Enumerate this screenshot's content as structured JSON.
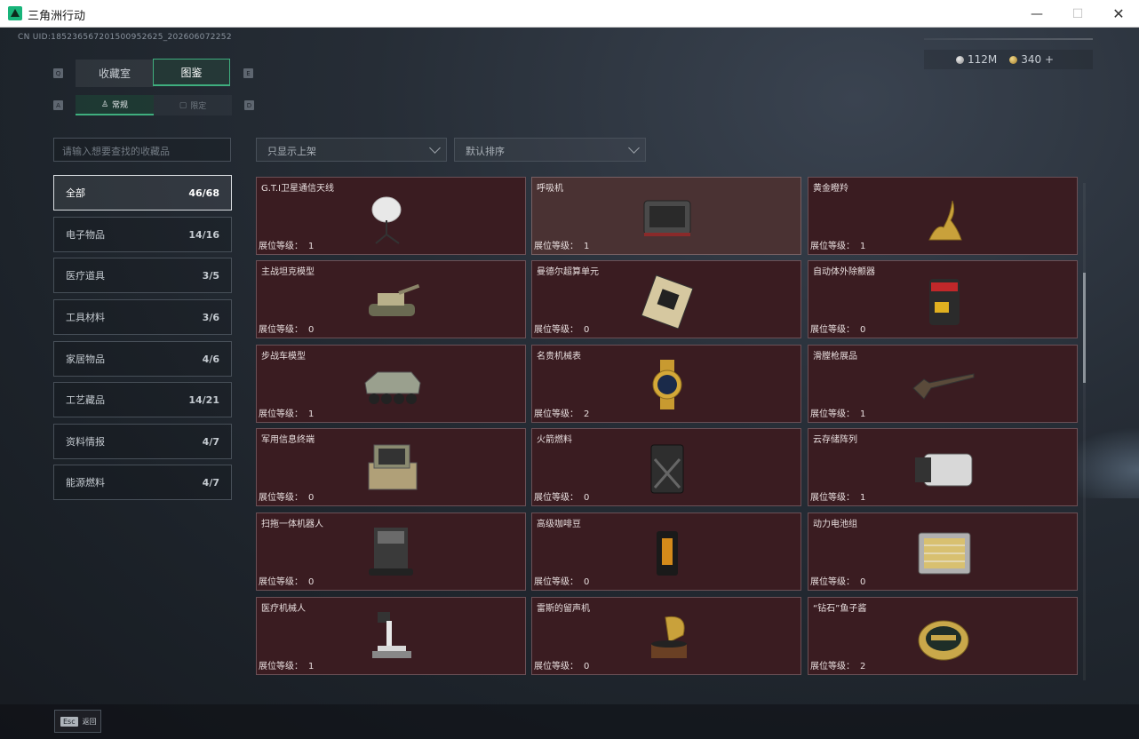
{
  "window": {
    "title": "三角洲行动",
    "minimize": "—",
    "maximize": "☐",
    "close": "✕"
  },
  "uid": "CN UID:18523656720150095262​5_202606072252",
  "currency": {
    "silver": "112M",
    "gold": "340 +"
  },
  "tabs": {
    "left_key": "Q",
    "right_key": "E",
    "collection": "收藏室",
    "atlas": "图鉴"
  },
  "subtabs": {
    "left_key": "A",
    "right_key": "D",
    "normal": "常规",
    "limited": "限定"
  },
  "search": {
    "placeholder": "请输入想要查找的收藏品"
  },
  "filters": {
    "shelf": "只显示上架",
    "sort": "默认排序"
  },
  "categories": [
    {
      "label": "全部",
      "count": "46/68"
    },
    {
      "label": "电子物品",
      "count": "14/16"
    },
    {
      "label": "医疗道具",
      "count": "3/5"
    },
    {
      "label": "工具材料",
      "count": "3/6"
    },
    {
      "label": "家居物品",
      "count": "4/6"
    },
    {
      "label": "工艺藏品",
      "count": "14/21"
    },
    {
      "label": "资料情报",
      "count": "4/7"
    },
    {
      "label": "能源燃料",
      "count": "4/7"
    }
  ],
  "level_label": "展位等级：",
  "items": [
    {
      "name": "G.T.I卫星通信天线",
      "level": "1",
      "icon": "satellite-dish-icon"
    },
    {
      "name": "呼吸机",
      "level": "1",
      "icon": "ventilator-icon"
    },
    {
      "name": "黄金瞪羚",
      "level": "1",
      "icon": "golden-gazelle-icon"
    },
    {
      "name": "主战坦克模型",
      "level": "0",
      "icon": "tank-model-icon"
    },
    {
      "name": "曼德尔超算单元",
      "level": "0",
      "icon": "supercomputer-unit-icon"
    },
    {
      "name": "自动体外除颤器",
      "level": "0",
      "icon": "defibrillator-icon"
    },
    {
      "name": "步战车模型",
      "level": "1",
      "icon": "ifv-model-icon"
    },
    {
      "name": "名贵机械表",
      "level": "2",
      "icon": "luxury-watch-icon"
    },
    {
      "name": "滑膛枪展品",
      "level": "1",
      "icon": "musket-icon"
    },
    {
      "name": "军用信息终端",
      "level": "0",
      "icon": "military-terminal-icon"
    },
    {
      "name": "火箭燃料",
      "level": "0",
      "icon": "rocket-fuel-icon"
    },
    {
      "name": "云存储阵列",
      "level": "1",
      "icon": "storage-array-icon"
    },
    {
      "name": "扫拖一体机器人",
      "level": "0",
      "icon": "robot-vacuum-icon"
    },
    {
      "name": "高级咖啡豆",
      "level": "0",
      "icon": "coffee-beans-icon"
    },
    {
      "name": "动力电池组",
      "level": "0",
      "icon": "battery-pack-icon"
    },
    {
      "name": "医疗机械人",
      "level": "1",
      "icon": "medical-robot-icon"
    },
    {
      "name": "雷斯的留声机",
      "level": "0",
      "icon": "gramophone-icon"
    },
    {
      "name": "“钻石”鱼子酱",
      "level": "2",
      "icon": "caviar-tin-icon"
    }
  ],
  "footer": {
    "esc_key": "Esc",
    "back": "返回"
  }
}
